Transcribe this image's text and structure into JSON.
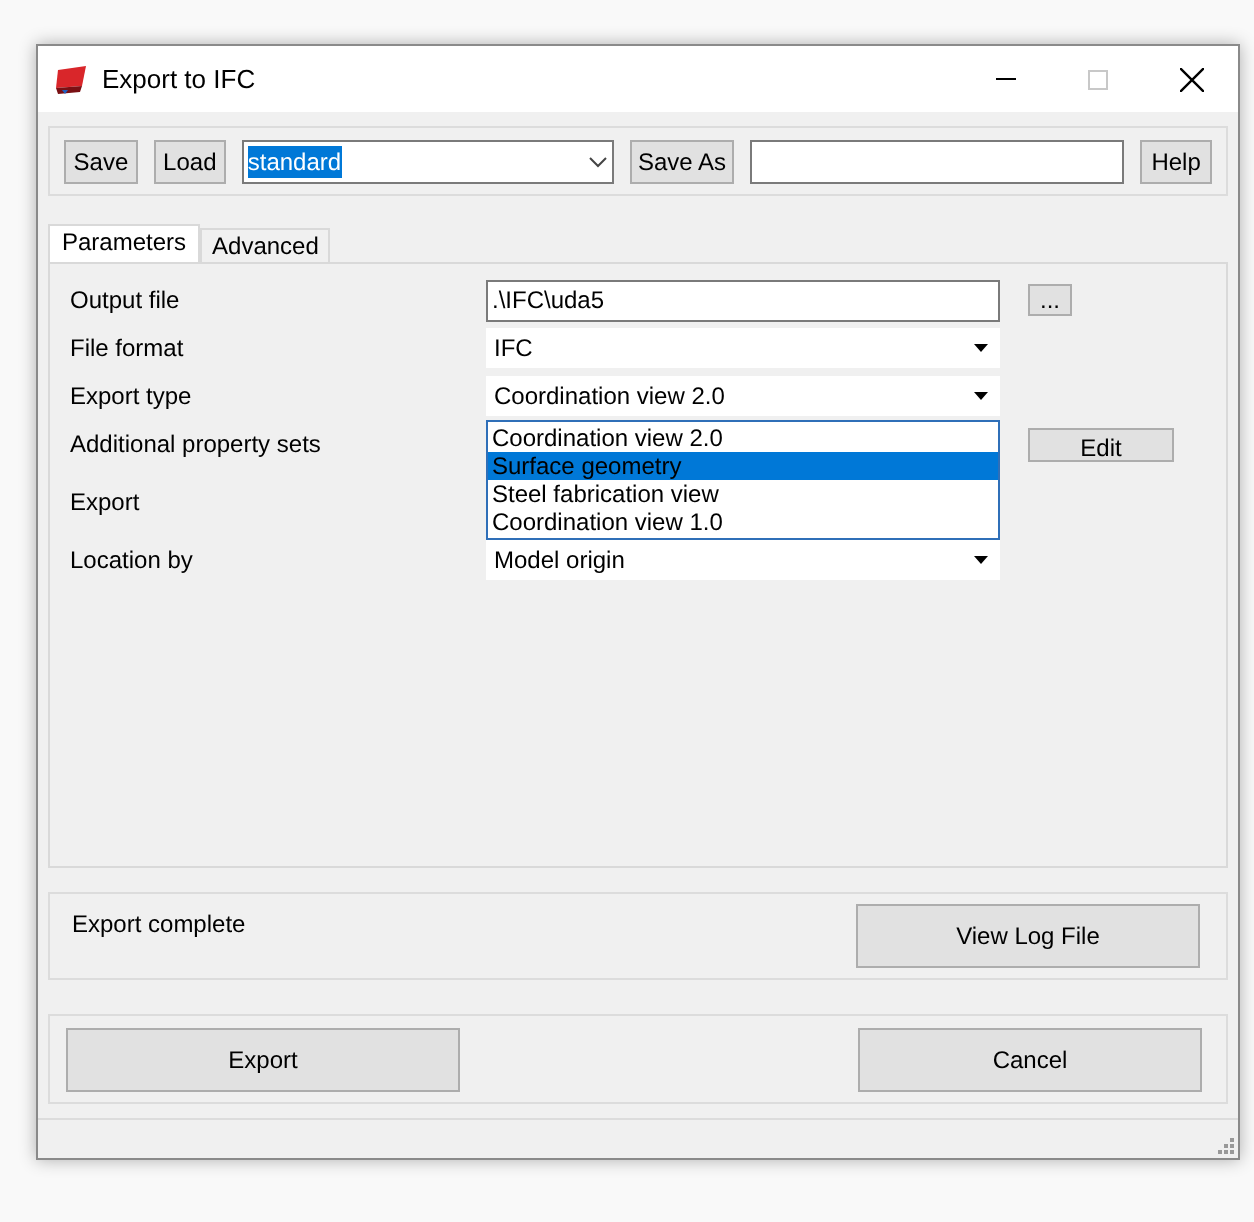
{
  "window": {
    "title": "Export to IFC"
  },
  "toolbar": {
    "save": "Save",
    "load": "Load",
    "preset": "standard",
    "save_as": "Save As",
    "help": "Help"
  },
  "tabs": [
    {
      "label": "Parameters",
      "selected": true
    },
    {
      "label": "Advanced",
      "selected": false
    }
  ],
  "rows": [
    {
      "kind": "text",
      "label": "Output file",
      "value": ".\\IFC\\uda5",
      "button": "..."
    },
    {
      "kind": "combo",
      "label": "File format",
      "value": "IFC"
    },
    {
      "kind": "combo",
      "label": "Export type",
      "value": "Coordination view 2.0",
      "options": [
        {
          "label": "Coordination view 2.0",
          "highlighted": false
        },
        {
          "label": "Surface geometry",
          "highlighted": true
        },
        {
          "label": "Steel fabrication view",
          "highlighted": false
        },
        {
          "label": "Coordination view 1.0",
          "highlighted": false
        }
      ]
    },
    {
      "kind": "button",
      "label": "Additional property sets",
      "button": "Edit"
    },
    {
      "kind": "hidden",
      "label": "Export"
    },
    {
      "kind": "combo",
      "label": "Location by",
      "value": "Model origin"
    }
  ],
  "status": {
    "message": "Export complete",
    "button": "View Log File"
  },
  "actions": {
    "export": "Export",
    "cancel": "Cancel"
  }
}
